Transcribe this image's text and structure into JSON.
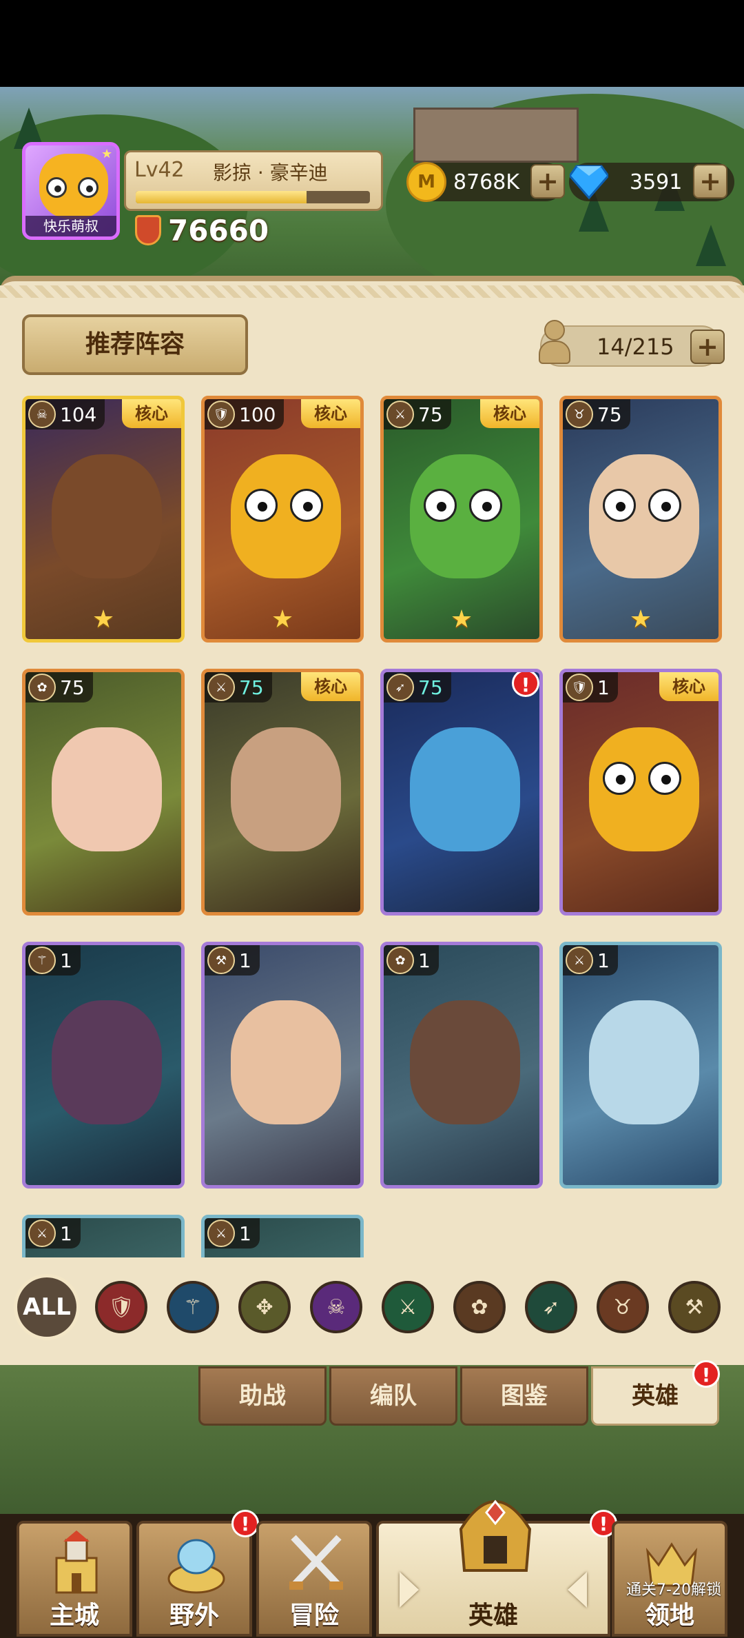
{
  "player": {
    "avatar_name": "快乐萌叔",
    "level": "Lv42",
    "name": "影掠 · 豪辛迪",
    "exp_fraction": 0.73,
    "power": "76660"
  },
  "currency": {
    "gold": "8768K",
    "diamond": "3591"
  },
  "panel": {
    "recommend_button": "推荐阵容",
    "hero_count": "14/215"
  },
  "heroes": [
    {
      "level": "104",
      "core": "核心",
      "star": "★",
      "class_icon": "skull-icon"
    },
    {
      "level": "100",
      "core": "核心",
      "star": "★",
      "class_icon": "shield-icon"
    },
    {
      "level": "75",
      "core": "核心",
      "star": "★",
      "class_icon": "crossed-swords-icon"
    },
    {
      "level": "75",
      "core": "",
      "star": "★",
      "class_icon": "horned-skull-icon"
    },
    {
      "level": "75",
      "core": "",
      "star": "",
      "class_icon": "paw-icon"
    },
    {
      "level": "75",
      "core": "核心",
      "star": "",
      "class_icon": "crossed-swords-icon"
    },
    {
      "level": "75",
      "core": "",
      "star": "",
      "class_icon": "bow-icon",
      "alert": "!"
    },
    {
      "level": "1",
      "core": "核心",
      "star": "",
      "class_icon": "shield-icon"
    },
    {
      "level": "1",
      "core": "",
      "star": "",
      "class_icon": "staff-icon"
    },
    {
      "level": "1",
      "core": "",
      "star": "",
      "class_icon": "axe-icon"
    },
    {
      "level": "1",
      "core": "",
      "star": "",
      "class_icon": "paw-icon"
    },
    {
      "level": "1",
      "core": "",
      "star": "",
      "class_icon": "crossed-swords-icon"
    },
    {
      "level": "1",
      "core": "",
      "star": "",
      "class_icon": "crossed-swords-icon"
    },
    {
      "level": "1",
      "core": "",
      "star": "",
      "class_icon": "crossed-swords-icon"
    }
  ],
  "filters": {
    "all_label": "ALL",
    "icons": [
      "shield-icon",
      "staff-icon",
      "winged-icon",
      "skull-icon",
      "crossed-swords-icon",
      "paw-icon",
      "bow-icon",
      "horned-skull-icon",
      "hammer-icon"
    ]
  },
  "subtabs": {
    "assist": "助战",
    "formation": "编队",
    "codex": "图鉴",
    "hero": "英雄",
    "hero_alert": "!"
  },
  "nav": {
    "main_city": "主城",
    "wild": "野外",
    "wild_alert": "!",
    "adventure": "冒险",
    "hero": "英雄",
    "hero_alert": "!",
    "territory": "领地",
    "territory_lock": "通关7-20解锁"
  },
  "colors": {
    "panel_bg": "#efe3c6",
    "gold_border": "#f0c83a",
    "purple_border": "#a57bd8",
    "alert_red": "#e32222"
  }
}
